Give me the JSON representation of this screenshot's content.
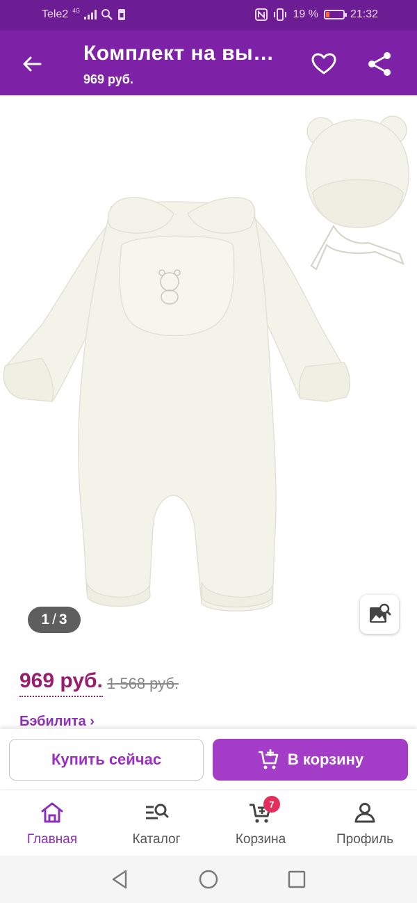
{
  "status_bar": {
    "carrier": "Tele2",
    "network": "4G",
    "battery_percent": "19 %",
    "battery_level": 0.19,
    "time": "21:32",
    "icons": [
      "signal-icon",
      "search-icon",
      "sim-icon",
      "nfc-icon",
      "vibrate-icon",
      "battery-icon"
    ]
  },
  "app_bar": {
    "title": "Комплект на вы…",
    "price": "969 руб.",
    "icons": [
      "back-arrow-icon",
      "heart-icon",
      "share-icon"
    ]
  },
  "gallery": {
    "current": "1",
    "separator": "/",
    "total": "3",
    "icons": [
      "image-search-icon"
    ]
  },
  "product": {
    "price": "969 руб.",
    "old_price": "1 568 руб.",
    "brand": "Бэбилита ›"
  },
  "actions": {
    "buy_now": "Купить сейчас",
    "add_to_cart": "В корзину"
  },
  "bottom_nav": {
    "items": [
      {
        "label": "Главная",
        "icon": "home-icon",
        "active": true
      },
      {
        "label": "Каталог",
        "icon": "catalog-search-icon",
        "active": false
      },
      {
        "label": "Корзина",
        "icon": "cart-icon",
        "active": false,
        "badge": "7"
      },
      {
        "label": "Профиль",
        "icon": "profile-icon",
        "active": false
      }
    ]
  },
  "colors": {
    "status_bar": "#6c1d93",
    "app_bar": "#7d22a6",
    "accent": "#a33cc7",
    "price": "#9a1c6c",
    "badge": "#e62e5c"
  }
}
